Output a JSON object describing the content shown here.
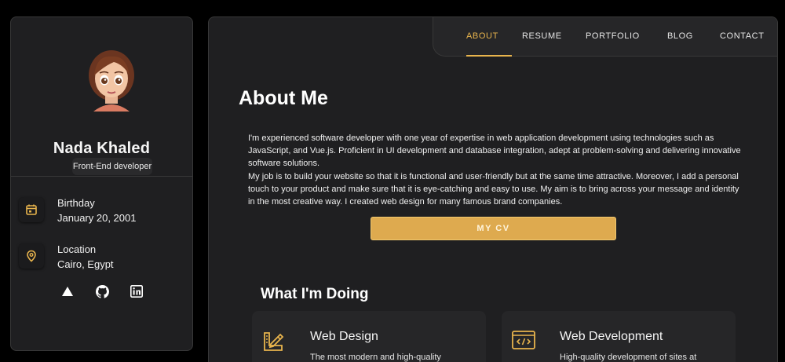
{
  "profile": {
    "name": "Nada Khaled",
    "role": "Front-End developer",
    "avatar_icon": "avatar-illustration"
  },
  "contacts": [
    {
      "icon": "calendar-icon",
      "title": "Birthday",
      "value": "January 20, 2001"
    },
    {
      "icon": "location-pin-icon",
      "title": "Location",
      "value": "Cairo, Egypt"
    }
  ],
  "social": [
    {
      "icon": "triangle-icon"
    },
    {
      "icon": "github-icon"
    },
    {
      "icon": "linkedin-icon"
    }
  ],
  "nav": {
    "items": [
      "ABOUT",
      "RESUME",
      "PORTFOLIO",
      "BLOG",
      "CONTACT"
    ],
    "active": "ABOUT"
  },
  "about": {
    "title": "About Me",
    "paragraph1": "I'm experienced software developer with one year of expertise in web application development using technologies such as JavaScript, and Vue.js. Proficient in UI development and database integration, adept at problem-solving and delivering innovative software solutions.",
    "paragraph2": "My job is to build your website so that it is functional and user-friendly but at the same time attractive. Moreover, I add a personal touch to your product and make sure that it is eye-catching and easy to use. My aim is to bring across your message and identity in the most creative way. I created web design for many famous brand companies.",
    "cv_button": "MY CV"
  },
  "services": {
    "title": "What I'm Doing",
    "items": [
      {
        "icon": "design-pencil-icon",
        "title": "Web Design",
        "description": "The most modern and high-quality"
      },
      {
        "icon": "code-window-icon",
        "title": "Web Development",
        "description": "High-quality development of sites at"
      }
    ]
  },
  "colors": {
    "accent": "#e8b44d",
    "background": "#000000",
    "panel": "#1f1f21",
    "button": "#deaa4f"
  }
}
